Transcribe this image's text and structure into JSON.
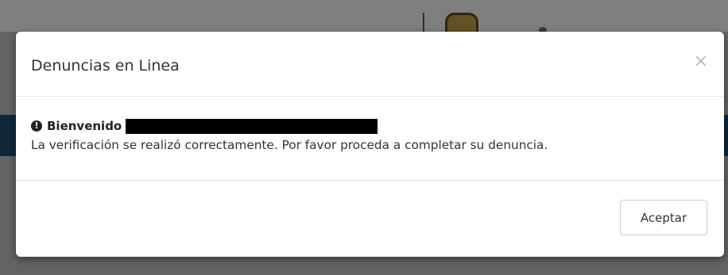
{
  "modal": {
    "title": "Denuncias en Linea",
    "close_label": "×",
    "body": {
      "welcome_label": "Bienvenido",
      "message": "La verificación se realizó correctamente. Por favor proceda a completar su denuncia."
    },
    "footer": {
      "accept_label": "Aceptar"
    }
  },
  "icons": {
    "alert": "exclamation-circle-icon",
    "close": "close-icon"
  },
  "colors": {
    "title_text": "#333333",
    "overlay": "rgba(0,0,0,0.5)",
    "background_stripe": "#1f4f73"
  }
}
